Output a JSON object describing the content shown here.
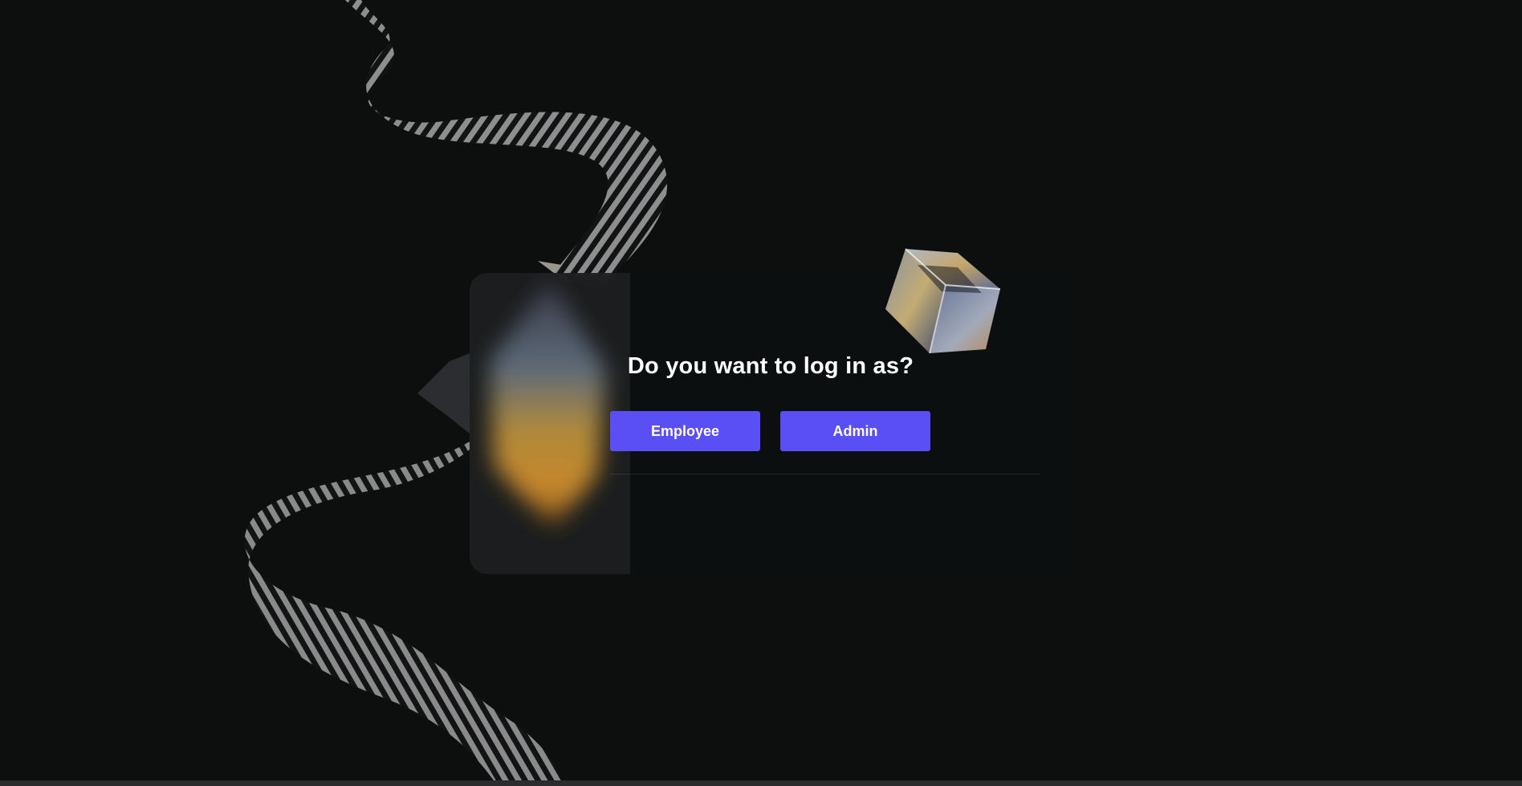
{
  "dialog": {
    "title": "Do you want to log in as?",
    "options": {
      "employee_label": "Employee",
      "admin_label": "Admin"
    }
  },
  "colors": {
    "background": "#0d0f0f",
    "button": "#5a4ff5",
    "button_text": "#ffffff",
    "title_text": "#ffffff"
  },
  "decorations": {
    "ribbon": "striped-ribbon-graphic",
    "gem": "crystal-gem-graphic",
    "cube": "glass-cube-graphic"
  }
}
